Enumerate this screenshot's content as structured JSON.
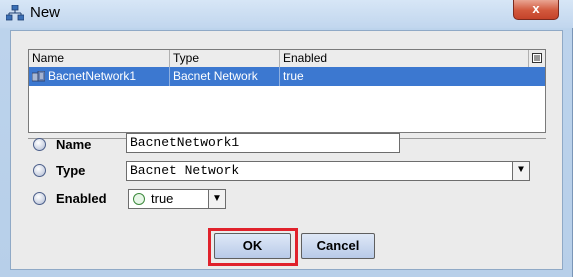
{
  "window": {
    "title": "New",
    "close_glyph": "x"
  },
  "table": {
    "columns": [
      "Name",
      "Type",
      "Enabled"
    ],
    "menu_icon": "table-menu-icon",
    "rows": [
      {
        "name": "BacnetNetwork1",
        "type": "Bacnet Network",
        "enabled": "true",
        "selected": true
      }
    ]
  },
  "form": {
    "name_label": "Name",
    "name_value": "BacnetNetwork1",
    "type_label": "Type",
    "type_value": "Bacnet Network",
    "enabled_label": "Enabled",
    "enabled_value": "true"
  },
  "buttons": {
    "ok": "OK",
    "cancel": "Cancel"
  },
  "colors": {
    "selection": "#3c78d0",
    "highlight": "#e0212b",
    "chrome": "#bcd3ec"
  }
}
